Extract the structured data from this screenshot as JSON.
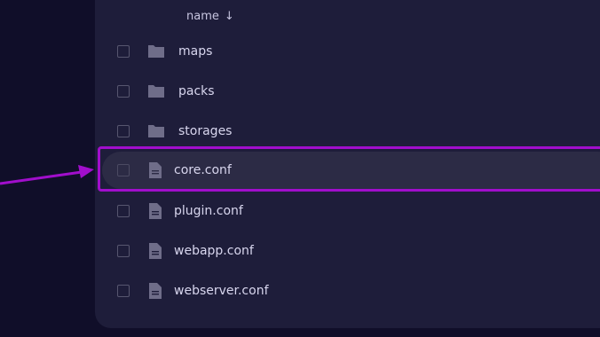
{
  "table": {
    "sort_column_label": "name",
    "sort_direction_icon": "sort-descending-icon",
    "sort_arrow_glyph": "↓",
    "rows": [
      {
        "name": "maps",
        "type": "folder"
      },
      {
        "name": "packs",
        "type": "folder"
      },
      {
        "name": "storages",
        "type": "folder"
      },
      {
        "name": "core.conf",
        "type": "file",
        "highlighted": true
      },
      {
        "name": "plugin.conf",
        "type": "file"
      },
      {
        "name": "webapp.conf",
        "type": "file"
      },
      {
        "name": "webserver.conf",
        "type": "file"
      }
    ]
  },
  "colors": {
    "page_background": "#100e29",
    "panel_background": "#1e1d3a",
    "selected_row_background": "#2c2b45",
    "annotation_accent": "#a10ecc",
    "icon_color": "#6f6d89",
    "text_color": "#d8d6ee"
  }
}
